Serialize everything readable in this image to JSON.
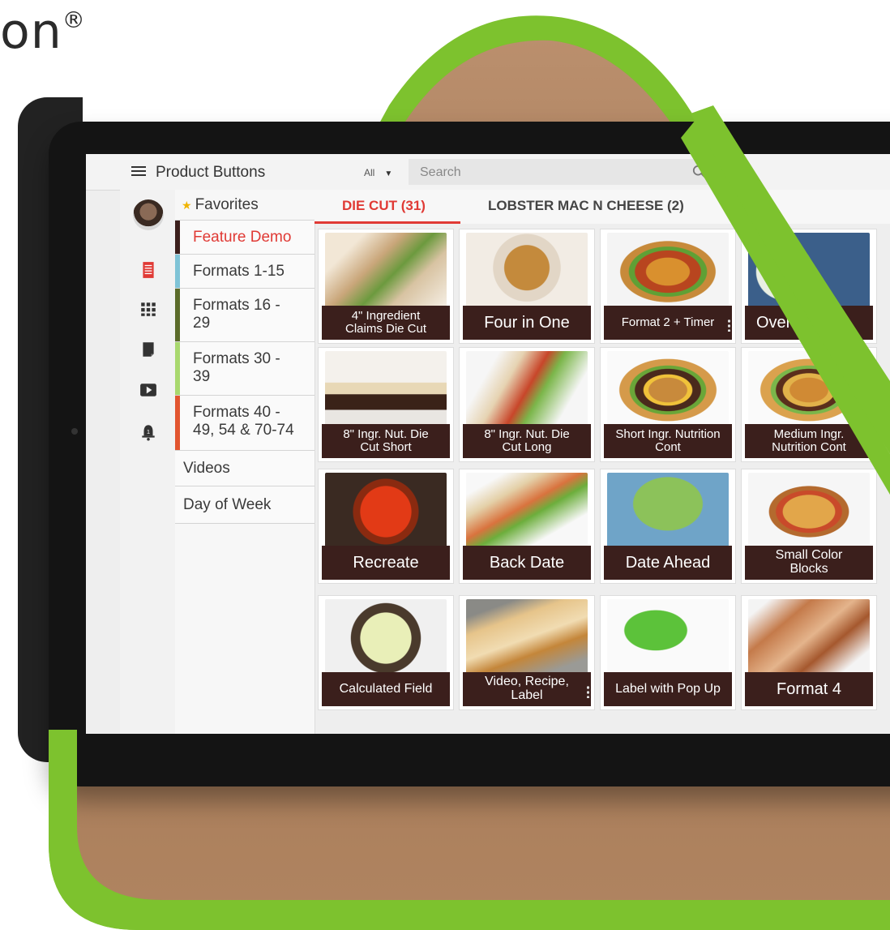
{
  "brand": {
    "text": "on",
    "mark": "®"
  },
  "topbar": {
    "title": "Product Buttons",
    "filter_value": "All",
    "search_placeholder": "Search"
  },
  "rail": {
    "icons": [
      "avatar",
      "list-icon",
      "grid-icon",
      "document-icon",
      "play-icon",
      "bell-icon"
    ],
    "notification_count": "1"
  },
  "categories": [
    {
      "label": "Favorites",
      "color": ""
    },
    {
      "label": "Feature Demo",
      "color": "#3b1f1c"
    },
    {
      "label": "Formats 1-15",
      "color": "#7fc3d6"
    },
    {
      "label": "Formats 16 - 29",
      "color": "#5b6b2a"
    },
    {
      "label": "Formats 30 - 39",
      "color": "#a9d86e"
    },
    {
      "label": "Formats 40 - 49, 54 & 70-74",
      "color": "#e2552f"
    },
    {
      "label": "Videos",
      "color": ""
    },
    {
      "label": "Day of Week",
      "color": ""
    }
  ],
  "tabs": [
    {
      "label": "DIE CUT (31)"
    },
    {
      "label": "LOBSTER MAC N CHEESE (2)"
    }
  ],
  "tiles": [
    {
      "label": "4\" Ingredient Claims Die Cut"
    },
    {
      "label": "Four in One"
    },
    {
      "label": "Format 2 + Timer"
    },
    {
      "label": "Overri"
    },
    {
      "label": "8\" Ingr. Nut. Die Cut Short"
    },
    {
      "label": "8\" Ingr. Nut.  Die Cut Long"
    },
    {
      "label": "Short Ingr. Nutrition Cont"
    },
    {
      "label": "Medium Ingr. Nutrition Cont"
    },
    {
      "label": "Recreate"
    },
    {
      "label": "Back Date"
    },
    {
      "label": "Date Ahead"
    },
    {
      "label": "Small Color Blocks"
    },
    {
      "label": "Calculated Field"
    },
    {
      "label": "Video, Recipe, Label"
    },
    {
      "label": "Label with Pop Up"
    },
    {
      "label": "Format 4"
    }
  ],
  "colors": {
    "accent_green": "#7dc22e",
    "active_red": "#e03a35",
    "tile_label_bg": "#3b1f1c"
  }
}
